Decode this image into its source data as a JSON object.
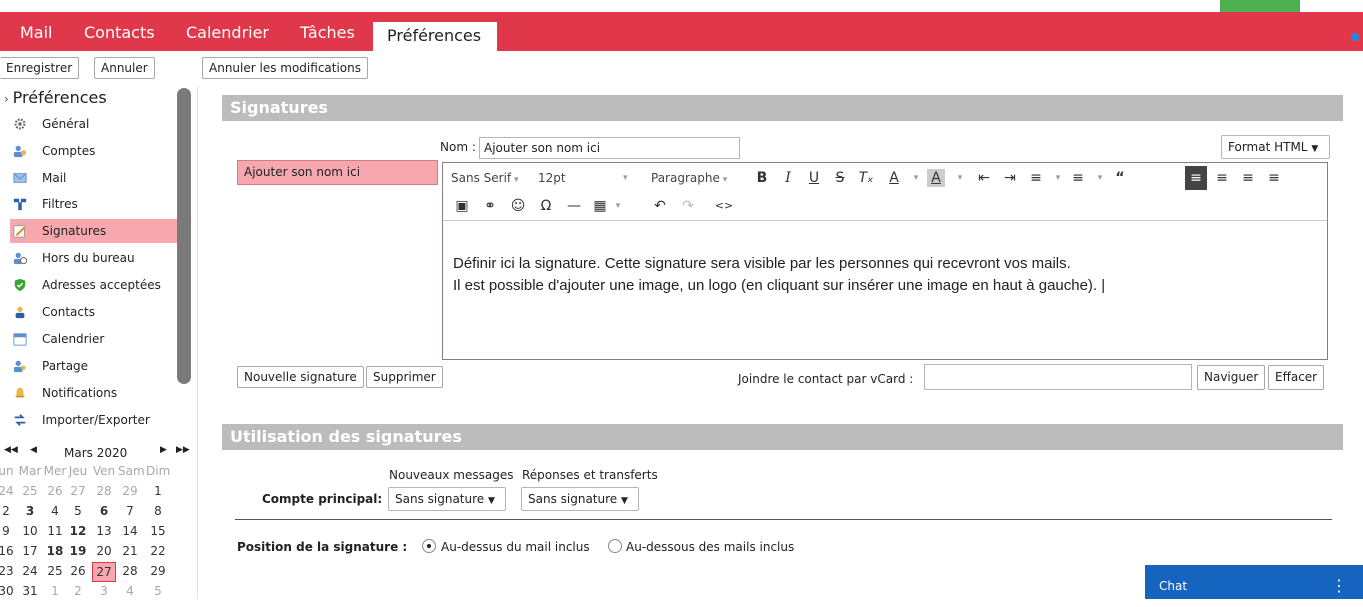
{
  "header": {
    "tabs": [
      {
        "label": "Mail"
      },
      {
        "label": "Contacts"
      },
      {
        "label": "Calendrier"
      },
      {
        "label": "Tâches"
      },
      {
        "label": "Préférences"
      }
    ]
  },
  "toolbar": {
    "save": "Enregistrer",
    "cancel": "Annuler",
    "revert": "Annuler les modifications"
  },
  "sidebar": {
    "title": "Préférences",
    "items": [
      {
        "label": "Général",
        "icon": "gear-icon"
      },
      {
        "label": "Comptes",
        "icon": "accounts-icon"
      },
      {
        "label": "Mail",
        "icon": "mail-icon"
      },
      {
        "label": "Filtres",
        "icon": "filter-icon"
      },
      {
        "label": "Signatures",
        "icon": "signature-icon"
      },
      {
        "label": "Hors du bureau",
        "icon": "out-of-office-icon"
      },
      {
        "label": "Adresses acceptées",
        "icon": "shield-icon"
      },
      {
        "label": "Contacts",
        "icon": "contact-icon"
      },
      {
        "label": "Calendrier",
        "icon": "calendar-icon"
      },
      {
        "label": "Partage",
        "icon": "share-icon"
      },
      {
        "label": "Notifications",
        "icon": "bell-icon"
      },
      {
        "label": "Importer/Exporter",
        "icon": "import-export-icon"
      }
    ]
  },
  "calendar": {
    "month": "Mars 2020",
    "days": [
      "un",
      "Mar",
      "Mer",
      "Jeu",
      "Ven",
      "Sam",
      "Dim"
    ],
    "weeks": [
      [
        "24",
        "25",
        "26",
        "27",
        "28",
        "29",
        "1"
      ],
      [
        "2",
        "3",
        "4",
        "5",
        "6",
        "7",
        "8"
      ],
      [
        "9",
        "10",
        "11",
        "12",
        "13",
        "14",
        "15"
      ],
      [
        "16",
        "17",
        "18",
        "19",
        "20",
        "21",
        "22"
      ],
      [
        "23",
        "24",
        "25",
        "26",
        "27",
        "28",
        "29"
      ],
      [
        "30",
        "31",
        "1",
        "2",
        "3",
        "4",
        "5"
      ]
    ]
  },
  "signatures": {
    "section_title": "Signatures",
    "list": [
      "Ajouter son nom ici"
    ],
    "name_label": "Nom :",
    "name_value": "Ajouter son nom ici",
    "format": "Format HTML",
    "editor": {
      "font": "Sans Serif",
      "size": "12pt",
      "block": "Paragraphe",
      "line1": "Définir ici la signature. Cette signature sera visible par les personnes qui recevront vos mails.",
      "line2": "Il est possible d'ajouter une image, un logo (en cliquant sur insérer une image en haut à gauche)."
    },
    "new_button": "Nouvelle signature",
    "delete_button": "Supprimer",
    "vcard_label": "Joindre le contact par vCard :",
    "browse_button": "Naviguer",
    "clear_button": "Effacer"
  },
  "usage": {
    "section_title": "Utilisation des signatures",
    "col_new": "Nouveaux messages",
    "col_reply": "Réponses et transferts",
    "account_label": "Compte principal:",
    "new_value": "Sans signature",
    "reply_value": "Sans signature",
    "position_label": "Position de la signature :",
    "opt_above": "Au-dessus du mail inclus",
    "opt_below": "Au-dessous des mails inclus"
  },
  "chat": {
    "label": "Chat"
  },
  "colors": {
    "accent": "#e0384a",
    "selected": "#f6a8ae",
    "chat": "#1565c0"
  }
}
